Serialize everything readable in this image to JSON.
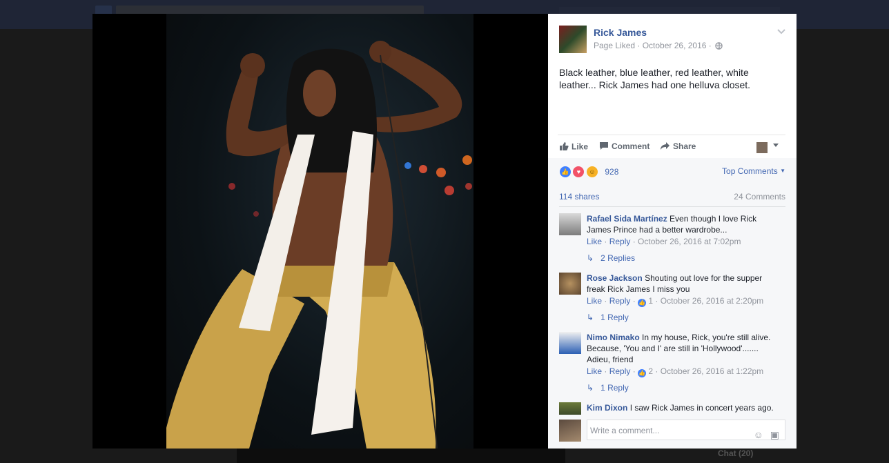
{
  "post": {
    "page_name": "Rick James",
    "meta": "Page Liked · October 26, 2016 ·",
    "text": "Black leather, blue leather, red leather, white leather... Rick James had one helluva closet."
  },
  "actions": {
    "like": "Like",
    "comment": "Comment",
    "share": "Share"
  },
  "stats": {
    "reaction_count": "928",
    "sort_label": "Top Comments",
    "shares": "114 shares",
    "comments": "24 Comments"
  },
  "comments": [
    {
      "name": "Rafael Sida Martínez",
      "text": "Even though I love Rick James Prince had a better wardrobe...",
      "like": "Like",
      "reply": "Reply",
      "likes": "",
      "time": "October 26, 2016 at 7:02pm",
      "replies": "2 Replies"
    },
    {
      "name": "Rose Jackson",
      "text": "Shouting out love for the supper freak Rick James I miss you",
      "like": "Like",
      "reply": "Reply",
      "likes": "1",
      "time": "October 26, 2016 at 2:20pm",
      "replies": "1 Reply"
    },
    {
      "name": "Nimo Nimako",
      "text": "In my house, Rick, you're still alive. Because, 'You and I' are still in 'Hollywood'....... Adieu, friend",
      "like": "Like",
      "reply": "Reply",
      "likes": "2",
      "time": "October 26, 2016 at 1:22pm",
      "replies": "1 Reply"
    },
    {
      "name": "Kim Dixon",
      "text": "I saw Rick James in concert years ago."
    }
  ],
  "composer": {
    "placeholder": "Write a comment..."
  },
  "background": {
    "chat": "Chat (20)"
  },
  "colors": {
    "link": "#365899",
    "accent": "#4267b2",
    "muted": "#90949c"
  }
}
